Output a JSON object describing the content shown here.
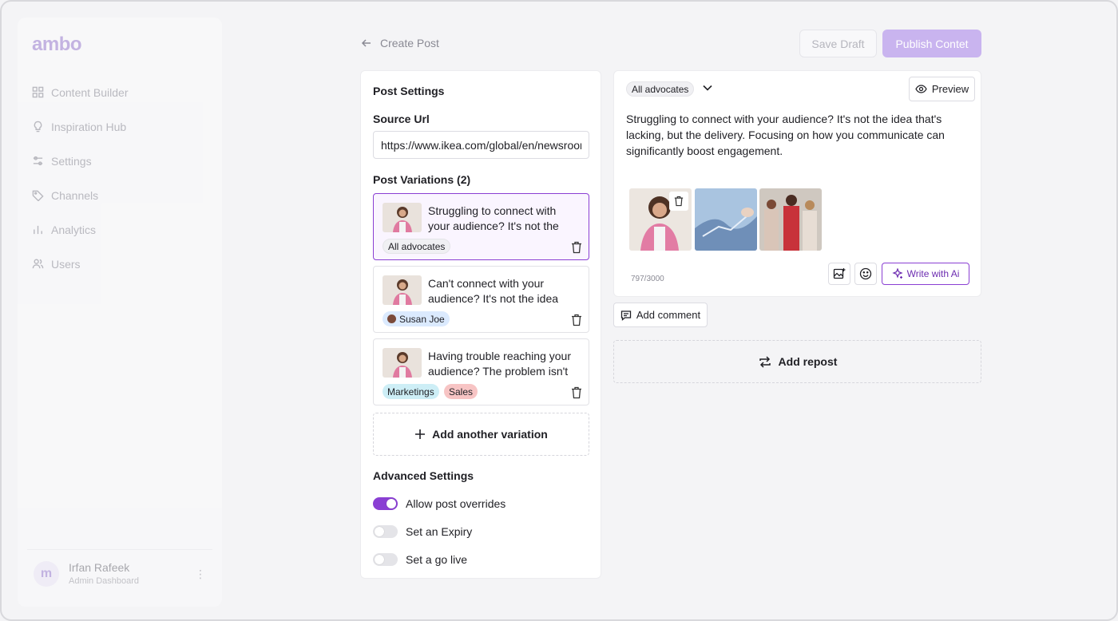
{
  "app": {
    "logo": "ambo"
  },
  "sidebar": {
    "items": [
      {
        "label": "Content Builder",
        "icon": "grid-icon"
      },
      {
        "label": "Inspiration Hub",
        "icon": "lightbulb-icon"
      },
      {
        "label": "Settings",
        "icon": "sliders-icon"
      },
      {
        "label": "Channels",
        "icon": "tag-icon"
      },
      {
        "label": "Analytics",
        "icon": "bar-chart-icon"
      },
      {
        "label": "Users",
        "icon": "users-icon"
      }
    ],
    "user": {
      "initial": "m",
      "name": "Irfan Rafeek",
      "role": "Admin Dashboard"
    }
  },
  "header": {
    "back_label": "Create Post",
    "save_draft": "Save Draft",
    "publish": "Publish Contet"
  },
  "post_settings": {
    "title": "Post Settings",
    "source_url_label": "Source Url",
    "source_url_value": "https://www.ikea.com/global/en/newsroom",
    "variations_title": "Post Variations (2)",
    "variations": [
      {
        "text": "Struggling to connect with your audience? It's not the",
        "tags": [
          {
            "label": "All advocates",
            "style": "gray"
          }
        ]
      },
      {
        "text": "Can't connect with your audience? It's not the idea",
        "tags": [
          {
            "label": "Susan Joe",
            "style": "blue"
          }
        ]
      },
      {
        "text": "Having trouble reaching your audience? The problem isn't",
        "tags": [
          {
            "label": "Marketings",
            "style": "cyan"
          },
          {
            "label": "Sales",
            "style": "red"
          }
        ]
      }
    ],
    "add_variation": "Add another variation",
    "advanced_title": "Advanced Settings",
    "toggles": [
      {
        "label": "Allow post overrides",
        "on": true
      },
      {
        "label": "Set an Expiry",
        "on": false
      },
      {
        "label": "Set a go live",
        "on": false
      }
    ]
  },
  "editor": {
    "audience": "All advocates",
    "preview": "Preview",
    "body": "Struggling to connect with your audience? It's not the idea that's lacking, but the delivery. Focusing on how you communicate can significantly boost engagement.",
    "char_count": "797/3000",
    "write_ai": "Write with Ai",
    "add_comment": "Add comment",
    "add_repost": "Add repost"
  },
  "colors": {
    "accent": "#8a3fd3",
    "publish_bg": "#c9b4ef"
  }
}
